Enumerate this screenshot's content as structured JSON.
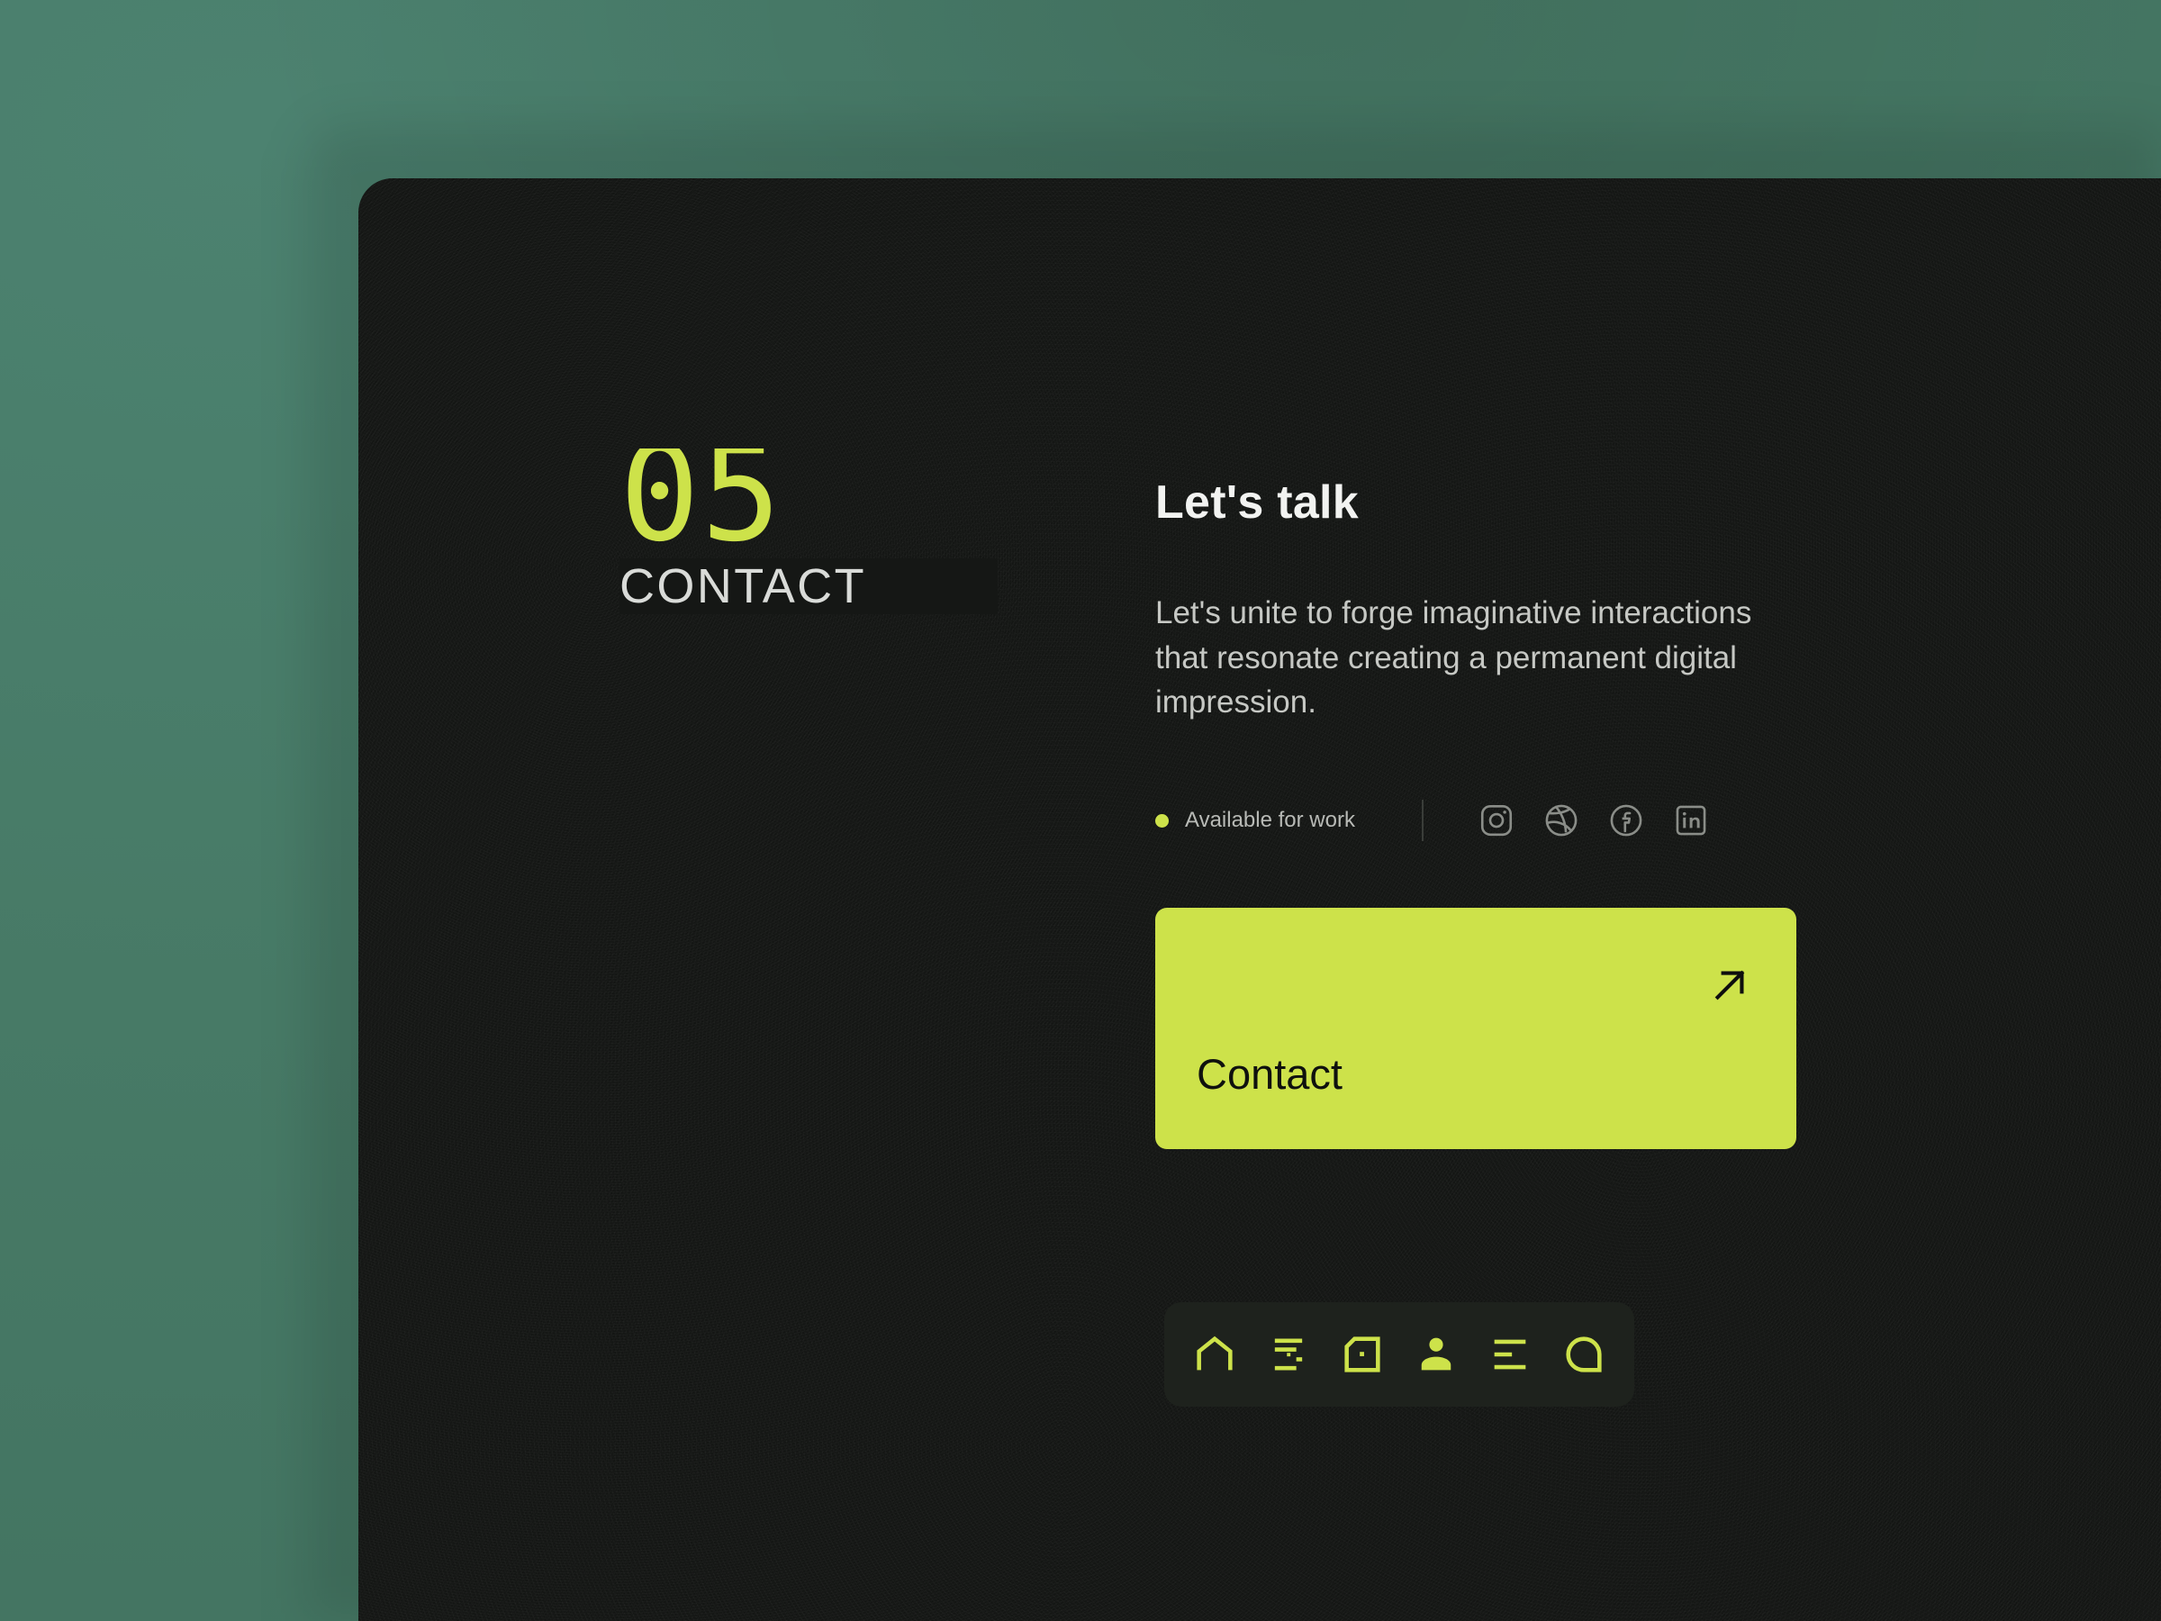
{
  "background": {
    "color": "#477a66"
  },
  "panel": {
    "color": "#151715",
    "accent": "#cde24a",
    "dock_color": "#1e221d"
  },
  "section": {
    "number": "05",
    "label": "CONTACT"
  },
  "content": {
    "headline": "Let's talk",
    "subcopy": "Let's unite to forge imaginative interactions that resonate creating a permanent digital impression.",
    "availability": {
      "status_text": "Available for work",
      "dot_color": "#cde24a"
    },
    "socials": [
      {
        "name": "instagram",
        "label": "Instagram"
      },
      {
        "name": "dribbble",
        "label": "Dribbble"
      },
      {
        "name": "facebook",
        "label": "Facebook"
      },
      {
        "name": "linkedin",
        "label": "LinkedIn"
      }
    ],
    "cta": {
      "label": "Contact",
      "icon": "arrow-up-right-icon",
      "background": "#cde24a",
      "text_color": "#0f110e"
    }
  },
  "dock": {
    "items": [
      {
        "name": "home",
        "label": "Home",
        "icon": "home-icon"
      },
      {
        "name": "services",
        "label": "Services",
        "icon": "services-icon"
      },
      {
        "name": "portfolio",
        "label": "Portfolio",
        "icon": "portfolio-icon"
      },
      {
        "name": "about",
        "label": "About",
        "icon": "person-icon"
      },
      {
        "name": "blog",
        "label": "Blog",
        "icon": "list-icon"
      },
      {
        "name": "contact",
        "label": "Contact",
        "icon": "chat-bubble-icon"
      }
    ]
  }
}
